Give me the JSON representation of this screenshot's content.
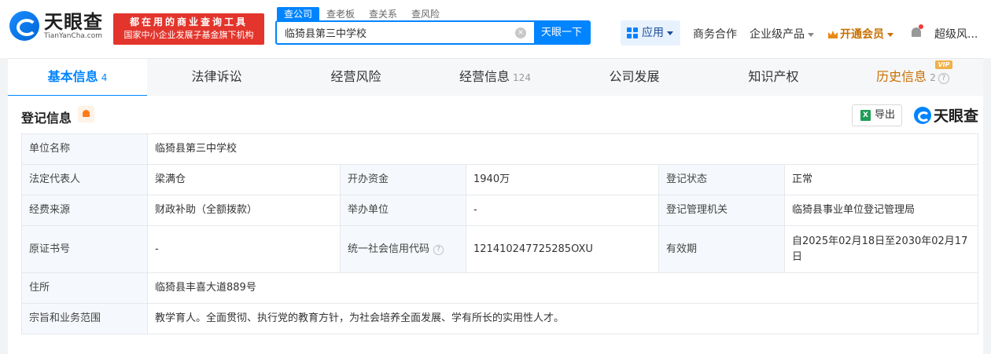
{
  "header": {
    "logo_cn": "天眼查",
    "logo_en": "TianYanCha.com",
    "slogan_line1": "都在用的商业查询工具",
    "slogan_line2": "国家中小企业发展子基金旗下机构",
    "search_tabs": [
      "查公司",
      "查老板",
      "查关系",
      "查风险"
    ],
    "search_value": "临猗县第三中学校",
    "search_button": "天眼一下",
    "apps_label": "应用",
    "nav": {
      "business": "商务合作",
      "enterprise": "企业级产品",
      "vip": "开通会员",
      "user": "超级风..."
    }
  },
  "tabs": [
    {
      "label": "基本信息",
      "count": "4"
    },
    {
      "label": "法律诉讼",
      "count": ""
    },
    {
      "label": "经营风险",
      "count": ""
    },
    {
      "label": "经营信息",
      "count": "124"
    },
    {
      "label": "公司发展",
      "count": ""
    },
    {
      "label": "知识产权",
      "count": ""
    },
    {
      "label": "历史信息",
      "count": "2",
      "vip": "VIP"
    }
  ],
  "section": {
    "title": "登记信息",
    "export_label": "导出",
    "excel_icon_text": "X",
    "brand": "天眼查"
  },
  "info": {
    "name_k": "单位名称",
    "name_v": "临猗县第三中学校",
    "legal_k": "法定代表人",
    "legal_v": "梁满仓",
    "capital_k": "开办资金",
    "capital_v": "1940万",
    "status_k": "登记状态",
    "status_v": "正常",
    "funding_k": "经费来源",
    "funding_v": "财政补助（全额拨款）",
    "sponsor_k": "举办单位",
    "sponsor_v": "-",
    "authority_k": "登记管理机关",
    "authority_v": "临猗县事业单位登记管理局",
    "cert_k": "原证书号",
    "cert_v": "-",
    "credit_k": "统一社会信用代码",
    "credit_v": "121410247725285OXU",
    "valid_k": "有效期",
    "valid_v": "自2025年02月18日至2030年02月17日",
    "addr_k": "住所",
    "addr_v": "临猗县丰喜大道889号",
    "scope_k": "宗旨和业务范围",
    "scope_v": "教学育人。全面贯彻、执行党的教育方针，为社会培养全面发展、学有所长的实用性人才。"
  },
  "colors": {
    "brand_blue": "#0084ff",
    "slogan_red": "#e3352c",
    "vip_orange": "#c96f00"
  }
}
